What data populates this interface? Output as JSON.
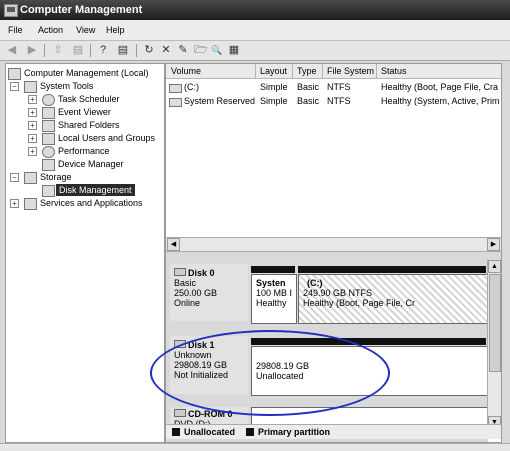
{
  "window": {
    "title": "Computer Management"
  },
  "menu": [
    "File",
    "Action",
    "View",
    "Help"
  ],
  "toolbar": {
    "back": "◀",
    "forward": "▶",
    "up": "⇧",
    "help": "?",
    "props": "▤",
    "refresh": "↻",
    "delete": "✕",
    "new": "✎",
    "open": "🗁",
    "search": "🔍",
    "options": "▦"
  },
  "tree": {
    "root": "Computer Management (Local)",
    "system_tools": "System Tools",
    "task_scheduler": "Task Scheduler",
    "event_viewer": "Event Viewer",
    "shared_folders": "Shared Folders",
    "local_users": "Local Users and Groups",
    "performance": "Performance",
    "device_manager": "Device Manager",
    "storage": "Storage",
    "disk_management": "Disk Management",
    "services": "Services and Applications"
  },
  "volumes": {
    "headers": [
      "Volume",
      "Layout",
      "Type",
      "File System",
      "Status"
    ],
    "rows": [
      [
        "(C:)",
        "Simple",
        "Basic",
        "NTFS",
        "Healthy (Boot, Page File, Cra"
      ],
      [
        "System Reserved",
        "Simple",
        "Basic",
        "NTFS",
        "Healthy (System, Active, Prim"
      ]
    ]
  },
  "disks": {
    "disk0": {
      "name": "Disk 0",
      "type": "Basic",
      "size": "250.00 GB",
      "state": "Online",
      "p1_name": "Systen",
      "p1_size": "100 MB I",
      "p1_status": "Healthy",
      "p2_name": "(C:)",
      "p2_size": "249.90 GB NTFS",
      "p2_status": "Healthy (Boot, Page File, Cr"
    },
    "disk1": {
      "name": "Disk 1",
      "type": "Unknown",
      "size": "29808.19 GB",
      "state": "Not Initialized",
      "p_size": "29808.19 GB",
      "p_status": "Unallocated"
    },
    "cdrom": {
      "name": "CD-ROM 0",
      "extra": "DVD (D:)"
    }
  },
  "legend": {
    "unallocated": "Unallocated",
    "primary": "Primary partition"
  },
  "colors": {
    "annotation": "#1f2fbf",
    "title_bar": "#2b2b2b",
    "selection": "#2a2a2a"
  }
}
